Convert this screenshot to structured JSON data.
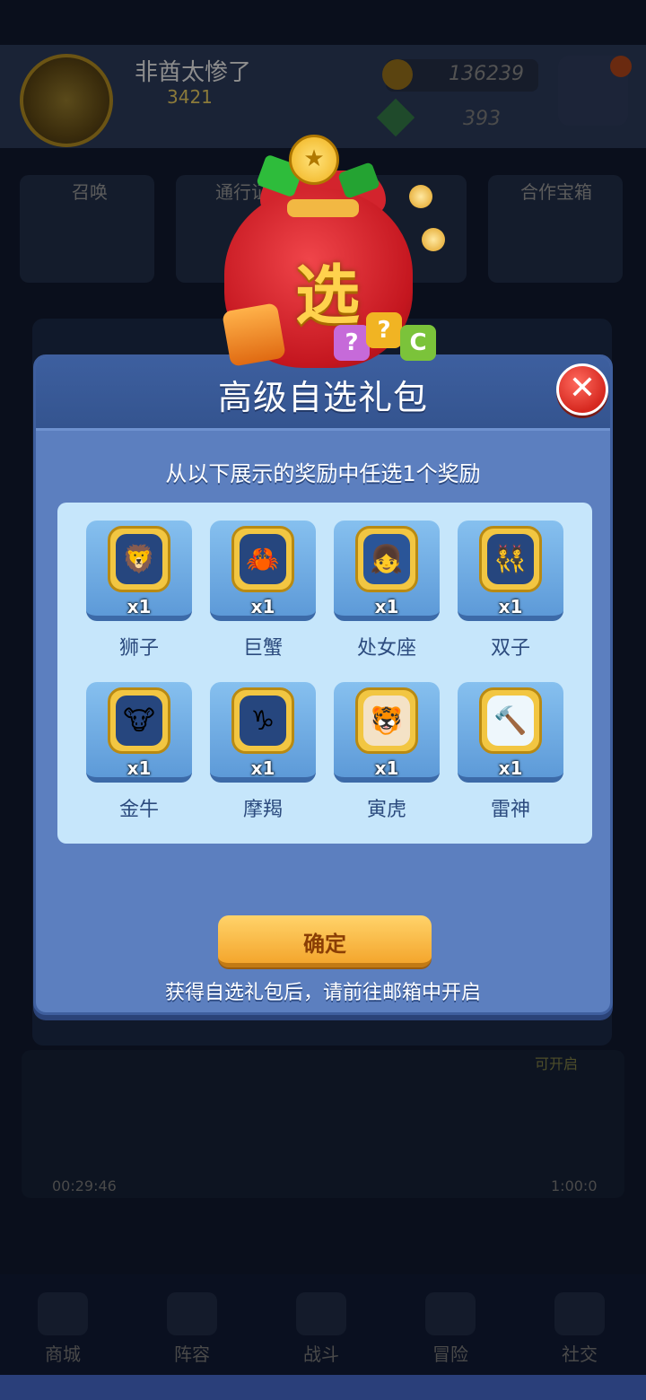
{
  "background": {
    "player_name": "非酋太惨了",
    "player_level": "3421",
    "coins": "136239",
    "gems": "393",
    "tiles": [
      "召唤",
      "通行证",
      "",
      "合作宝箱"
    ],
    "timer_left": "00:29:46",
    "timer_right": "1:00:0",
    "can_open": "可开启",
    "nav": [
      "商城",
      "阵容",
      "战斗",
      "冒险",
      "社交"
    ]
  },
  "modal": {
    "title": "高级自选礼包",
    "instruction": "从以下展示的奖励中任选1个奖励",
    "bag_char": "选",
    "confirm_label": "确定",
    "footer_note": "获得自选礼包后，请前往邮箱中开启",
    "items": [
      {
        "name": "狮子",
        "qty": "x1",
        "icon": "lion-icon",
        "glyph": "🦁",
        "bg": "#26467e"
      },
      {
        "name": "巨蟹",
        "qty": "x1",
        "icon": "crab-icon",
        "glyph": "🦀",
        "bg": "#26467e"
      },
      {
        "name": "处女座",
        "qty": "x1",
        "icon": "virgo-icon",
        "glyph": "👧",
        "bg": "#2a5598"
      },
      {
        "name": "双子",
        "qty": "x1",
        "icon": "gemini-icon",
        "glyph": "👯",
        "bg": "#26467e"
      },
      {
        "name": "金牛",
        "qty": "x1",
        "icon": "taurus-icon",
        "glyph": "🐮",
        "bg": "#26467e"
      },
      {
        "name": "摩羯",
        "qty": "x1",
        "icon": "capricorn-icon",
        "glyph": "♑",
        "bg": "#26467e"
      },
      {
        "name": "寅虎",
        "qty": "x1",
        "icon": "tiger-icon",
        "glyph": "🐯",
        "bg": "#f4e2c6"
      },
      {
        "name": "雷神",
        "qty": "x1",
        "icon": "thor-hammer-icon",
        "glyph": "🔨",
        "bg": "#eef7fc"
      }
    ]
  }
}
